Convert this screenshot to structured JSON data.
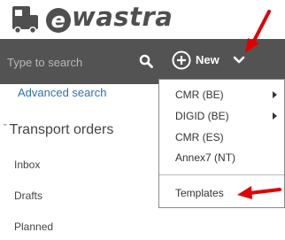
{
  "brand": {
    "name": "wastra",
    "initial": "e"
  },
  "search": {
    "placeholder": "Type to search"
  },
  "sidebar": {
    "advanced_search": "Advanced search",
    "section_title": "Transport orders",
    "items": [
      "Inbox",
      "Drafts",
      "Planned"
    ]
  },
  "toolbar": {
    "new_label": "New"
  },
  "dropdown": {
    "items": [
      "CMR (BE)",
      "DIGID (BE)",
      "CMR (ES)",
      "Annex7 (NT)"
    ],
    "templates_label": "Templates"
  },
  "colors": {
    "toolbar": "#535353",
    "link": "#2f6fae",
    "annotation_arrow": "#e00000"
  },
  "icons": [
    "truck-logo-icon",
    "search-icon",
    "plus-circle-icon",
    "chevron-down-icon",
    "submenu-arrow-icon",
    "annotation-arrow-icon"
  ]
}
